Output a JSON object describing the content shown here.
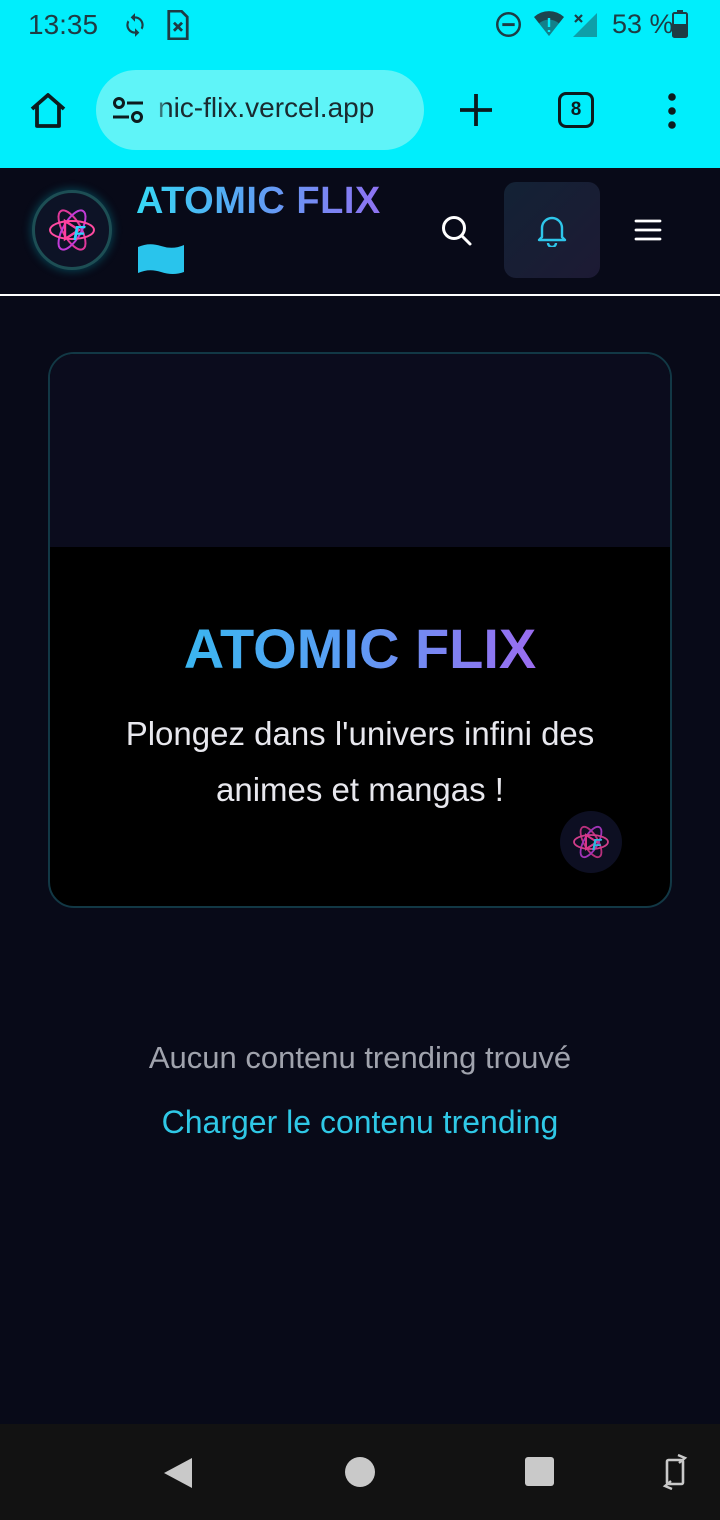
{
  "status_bar": {
    "time": "13:35",
    "battery": "53 %",
    "icons": [
      "sync-icon",
      "sim-error-icon",
      "do-not-disturb-icon",
      "wifi-icon",
      "no-signal-icon",
      "battery-icon"
    ]
  },
  "browser": {
    "url": "nic-flix.vercel.app",
    "tab_count": "8",
    "icons": [
      "home-icon",
      "site-settings-icon",
      "new-tab-icon",
      "tabs-icon",
      "more-menu-icon"
    ]
  },
  "header": {
    "brand": "ATOMIC FLIX",
    "icons": [
      "logo-icon",
      "flag-icon",
      "search-icon",
      "bell-icon",
      "hamburger-icon"
    ]
  },
  "hero": {
    "title": "ATOMIC FLIX",
    "tagline": "Plongez dans l'univers infini des animes et mangas !"
  },
  "trending": {
    "empty_message": "Aucun contenu trending trouvé",
    "load_link": "Charger le contenu trending"
  },
  "nav_bar": {
    "icons": [
      "back-icon",
      "home-circle-icon",
      "recents-icon",
      "rotate-icon"
    ]
  },
  "colors": {
    "browser_chrome": "#00eefc",
    "page_background": "#080a18",
    "accent_cyan": "#2fc8e6",
    "accent_purple": "#9a6cf0"
  }
}
